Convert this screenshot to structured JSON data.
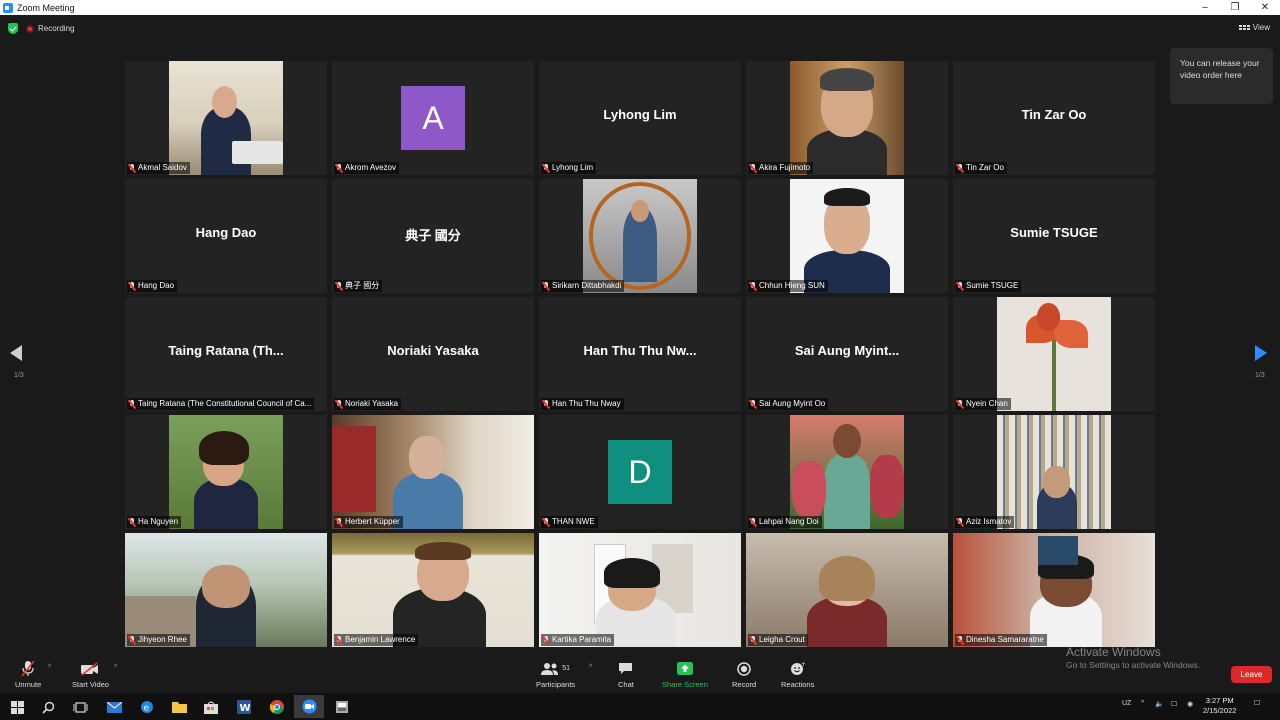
{
  "window": {
    "title": "Zoom Meeting"
  },
  "meeting": {
    "recording_label": "Recording",
    "view_label": "View",
    "tooltip": "You can release your video order here",
    "page_indicator_left": "1/3",
    "page_indicator_right": "1/3"
  },
  "participants": [
    {
      "name": "Akmal Saidov",
      "display": "video",
      "avatar_letter": "",
      "scene": "office"
    },
    {
      "name": "Akrom Avezov",
      "display": "avatar",
      "avatar_letter": "A",
      "avatar_color": "#8e58c8"
    },
    {
      "name": "Lyhong Lim",
      "display": "name",
      "big_name": "Lyhong Lim"
    },
    {
      "name": "Akira Fujimoto",
      "display": "video",
      "scene": "portrait-library"
    },
    {
      "name": "Tin Zar Oo",
      "display": "name",
      "big_name": "Tin Zar Oo"
    },
    {
      "name": "Hang Dao",
      "display": "name",
      "big_name": "Hang Dao"
    },
    {
      "name": "典子 國分",
      "display": "name",
      "big_name": "典子 國分"
    },
    {
      "name": "Sirikarn Dittabhakdi",
      "display": "video",
      "scene": "round-frame"
    },
    {
      "name": "Chhun Hieng SUN",
      "display": "video",
      "scene": "portrait-white"
    },
    {
      "name": "Sumie TSUGE",
      "display": "name",
      "big_name": "Sumie TSUGE"
    },
    {
      "name": "Taing Ratana (The Constitutional Council of Ca...",
      "display": "name",
      "big_name": "Taing Ratana (Th..."
    },
    {
      "name": "Noriaki Yasaka",
      "display": "name",
      "big_name": "Noriaki Yasaka"
    },
    {
      "name": "Han Thu Thu Nway",
      "display": "name",
      "big_name": "Han Thu Thu Nw..."
    },
    {
      "name": "Sai Aung Myint Oo",
      "display": "name",
      "big_name": "Sai Aung Myint..."
    },
    {
      "name": "Nyein Chan",
      "display": "video",
      "scene": "flower"
    },
    {
      "name": "Ha Nguyen",
      "display": "video",
      "scene": "garden"
    },
    {
      "name": "Herbert Küpper",
      "display": "video",
      "scene": "bookshelf-full"
    },
    {
      "name": "THAN NWE",
      "display": "avatar",
      "avatar_letter": "D",
      "avatar_color": "#0e8f80"
    },
    {
      "name": "Lahpai Nang Doi",
      "display": "video",
      "scene": "roses"
    },
    {
      "name": "Aziz Ismatov",
      "display": "video",
      "scene": "library"
    },
    {
      "name": "Jihyeon Rhee",
      "display": "video",
      "scene": "campus"
    },
    {
      "name": "Benjamin Lawrence",
      "display": "video",
      "scene": "art-wall",
      "active": true
    },
    {
      "name": "Kartika Paramita",
      "display": "video",
      "scene": "white-room"
    },
    {
      "name": "Leigha Crout",
      "display": "video",
      "scene": "living-room"
    },
    {
      "name": "Dinesha Samararatne",
      "display": "video",
      "scene": "red-room"
    }
  ],
  "toolbar": {
    "unmute": "Unmute",
    "start_video": "Start Video",
    "participants": "Participants",
    "participants_count": "51",
    "chat": "Chat",
    "share_screen": "Share Screen",
    "record": "Record",
    "reactions": "Reactions",
    "leave": "Leave"
  },
  "watermark": {
    "line1": "Activate Windows",
    "line2": "Go to Settings to activate Windows."
  },
  "taskbar": {
    "language": "UZ",
    "time": "3:27 PM",
    "date": "2/15/2022"
  },
  "colors": {
    "accent": "#2d8cff",
    "active_speaker": "#d4e157",
    "share_green": "#23c552",
    "leave_red": "#e02828"
  }
}
